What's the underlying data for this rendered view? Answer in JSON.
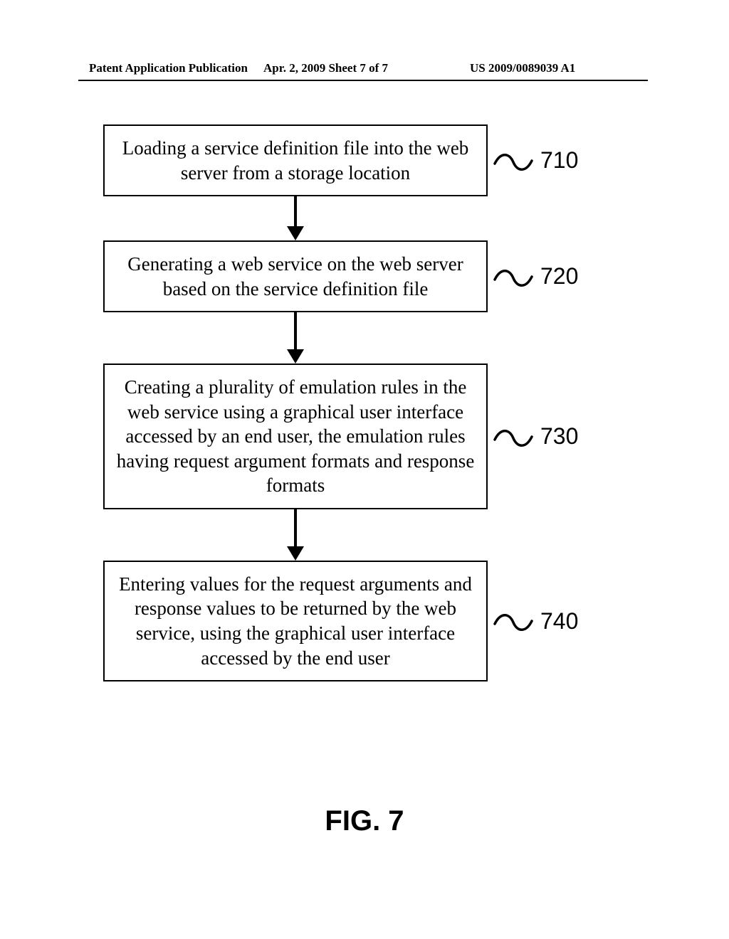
{
  "header": {
    "publication_type": "Patent Application Publication",
    "date_sheet": "Apr. 2, 2009  Sheet 7 of 7",
    "pub_number": "US 2009/0089039 A1"
  },
  "flowchart": {
    "steps": [
      {
        "ref": "710",
        "text": "Loading a service definition file into the web server from a storage location"
      },
      {
        "ref": "720",
        "text": "Generating a web service on the web server based on the service definition file"
      },
      {
        "ref": "730",
        "text": "Creating a plurality of emulation rules in the web service using a graphical user interface accessed by an end user, the emulation rules having request argument formats and response formats"
      },
      {
        "ref": "740",
        "text": "Entering values for the request arguments and response values to be returned by the web service, using the graphical user interface accessed by the end user"
      }
    ]
  },
  "figure_label": "FIG. 7",
  "chart_data": {
    "type": "flowchart",
    "title": "FIG. 7",
    "direction": "top-to-bottom",
    "nodes": [
      {
        "id": "710",
        "label": "Loading a service definition file into the web server from a storage location"
      },
      {
        "id": "720",
        "label": "Generating a web service on the web server based on the service definition file"
      },
      {
        "id": "730",
        "label": "Creating a plurality of emulation rules in the web service using a graphical user interface accessed by an end user, the emulation rules having request argument formats and response formats"
      },
      {
        "id": "740",
        "label": "Entering values for the request arguments and response values to be returned by the web service, using the graphical user interface accessed by the end user"
      }
    ],
    "edges": [
      {
        "from": "710",
        "to": "720"
      },
      {
        "from": "720",
        "to": "730"
      },
      {
        "from": "730",
        "to": "740"
      }
    ]
  }
}
